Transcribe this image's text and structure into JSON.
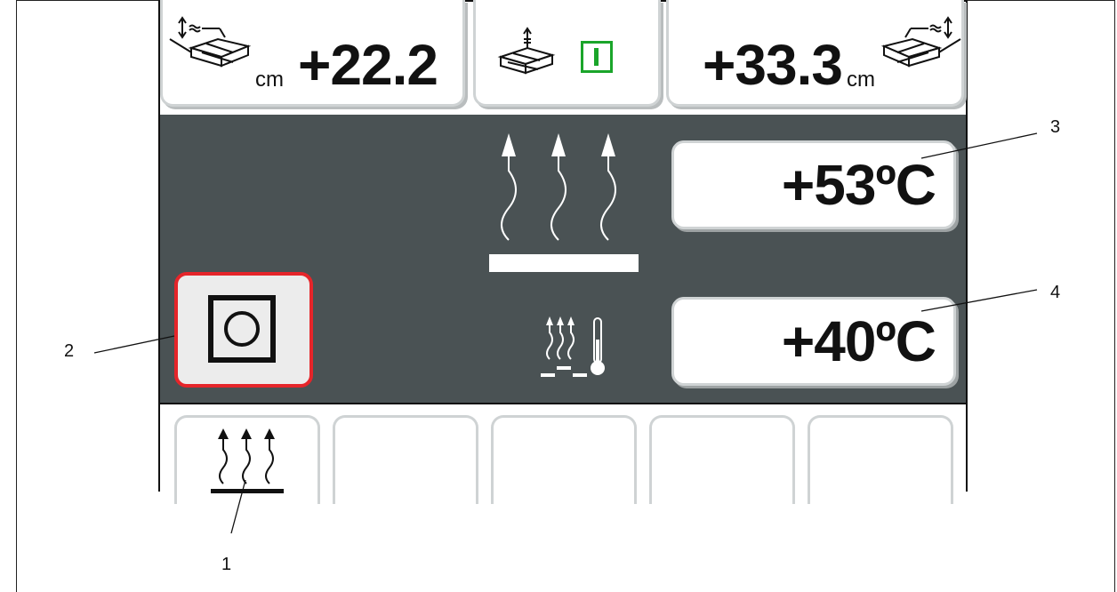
{
  "top_bar": {
    "left_height_value": "+22.2",
    "left_unit": "cm",
    "left_icon": "screed-height-left-icon",
    "mid_icon": "screed-sensor-icon",
    "mid_toggle_icon": "on-toggle-icon",
    "right_height_value": "+33.3",
    "right_unit": "cm",
    "right_icon": "screed-height-right-icon"
  },
  "main": {
    "heating_icon": "heating-large-icon",
    "temperature_actual": "+53ºC",
    "temperature_set": "+40ºC",
    "mode_icon": "screed-temperature-icon",
    "stop_button_icon": "stop-square-icon"
  },
  "soft_keys": [
    {
      "icon": "heating-icon",
      "label": ""
    },
    {
      "icon": "",
      "label": ""
    },
    {
      "icon": "",
      "label": ""
    },
    {
      "icon": "",
      "label": ""
    },
    {
      "icon": "",
      "label": ""
    }
  ],
  "callouts": {
    "c1": "1",
    "c2": "2",
    "c3": "3",
    "c4": "4"
  },
  "colors": {
    "screen_bg": "#4a5254",
    "toggle_green": "#1aa52a",
    "stop_border_red": "#e5252a"
  }
}
